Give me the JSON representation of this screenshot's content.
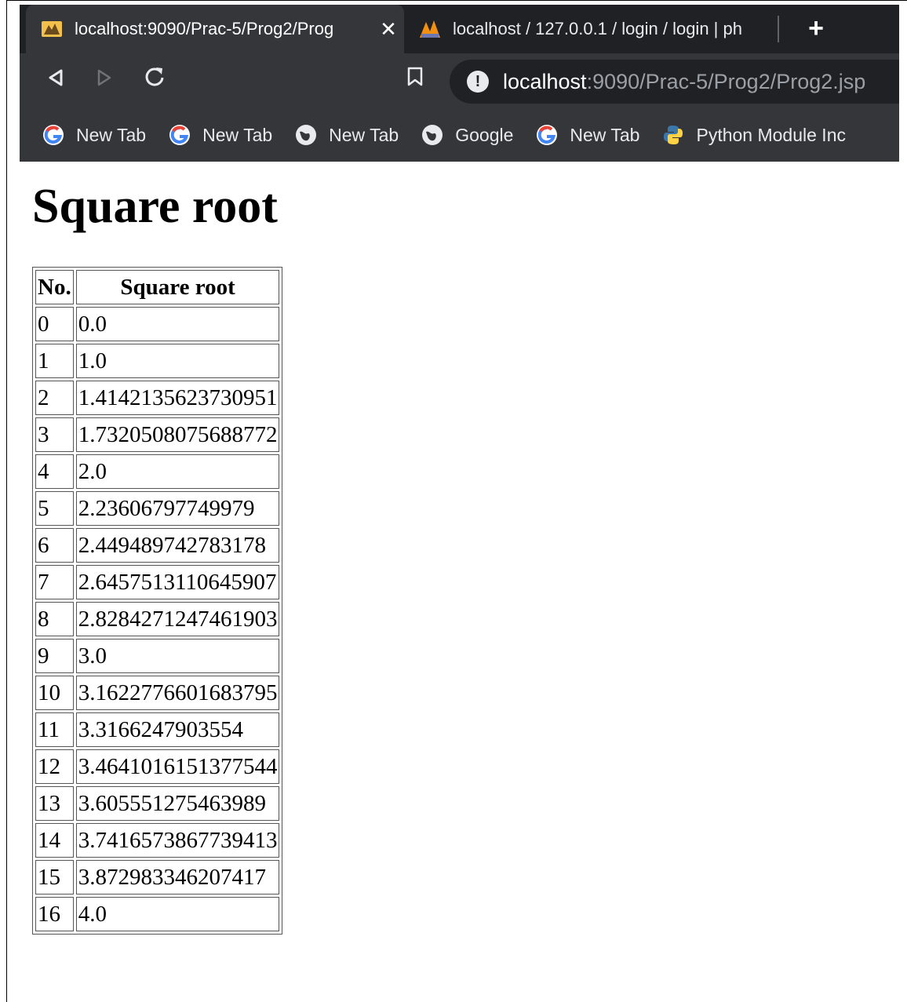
{
  "browser": {
    "tabs": [
      {
        "title": "localhost:9090/Prac-5/Prog2/Prog",
        "icon": "tomcat-icon",
        "active": true
      },
      {
        "title": "localhost / 127.0.0.1 / login / login | ph",
        "icon": "phpmyadmin-icon",
        "active": false
      }
    ],
    "close_glyph": "✕",
    "new_tab_glyph": "+",
    "address": {
      "host": "localhost",
      "rest": ":9090/Prac-5/Prog2/Prog2.jsp"
    },
    "bookmarks": [
      {
        "label": "New Tab",
        "icon": "google-icon"
      },
      {
        "label": "New Tab",
        "icon": "google-icon"
      },
      {
        "label": "New Tab",
        "icon": "globe-icon"
      },
      {
        "label": "Google",
        "icon": "globe-icon"
      },
      {
        "label": "New Tab",
        "icon": "google-icon"
      },
      {
        "label": "Python Module Inc",
        "icon": "python-icon"
      }
    ]
  },
  "page": {
    "heading": "Square root",
    "table": {
      "headers": [
        "No.",
        "Square root"
      ],
      "rows": [
        [
          "0",
          "0.0"
        ],
        [
          "1",
          "1.0"
        ],
        [
          "2",
          "1.4142135623730951"
        ],
        [
          "3",
          "1.7320508075688772"
        ],
        [
          "4",
          "2.0"
        ],
        [
          "5",
          "2.23606797749979"
        ],
        [
          "6",
          "2.449489742783178"
        ],
        [
          "7",
          "2.6457513110645907"
        ],
        [
          "8",
          "2.8284271247461903"
        ],
        [
          "9",
          "3.0"
        ],
        [
          "10",
          "3.1622776601683795"
        ],
        [
          "11",
          "3.3166247903554"
        ],
        [
          "12",
          "3.4641016151377544"
        ],
        [
          "13",
          "3.605551275463989"
        ],
        [
          "14",
          "3.7416573867739413"
        ],
        [
          "15",
          "3.872983346207417"
        ],
        [
          "16",
          "4.0"
        ]
      ]
    }
  }
}
